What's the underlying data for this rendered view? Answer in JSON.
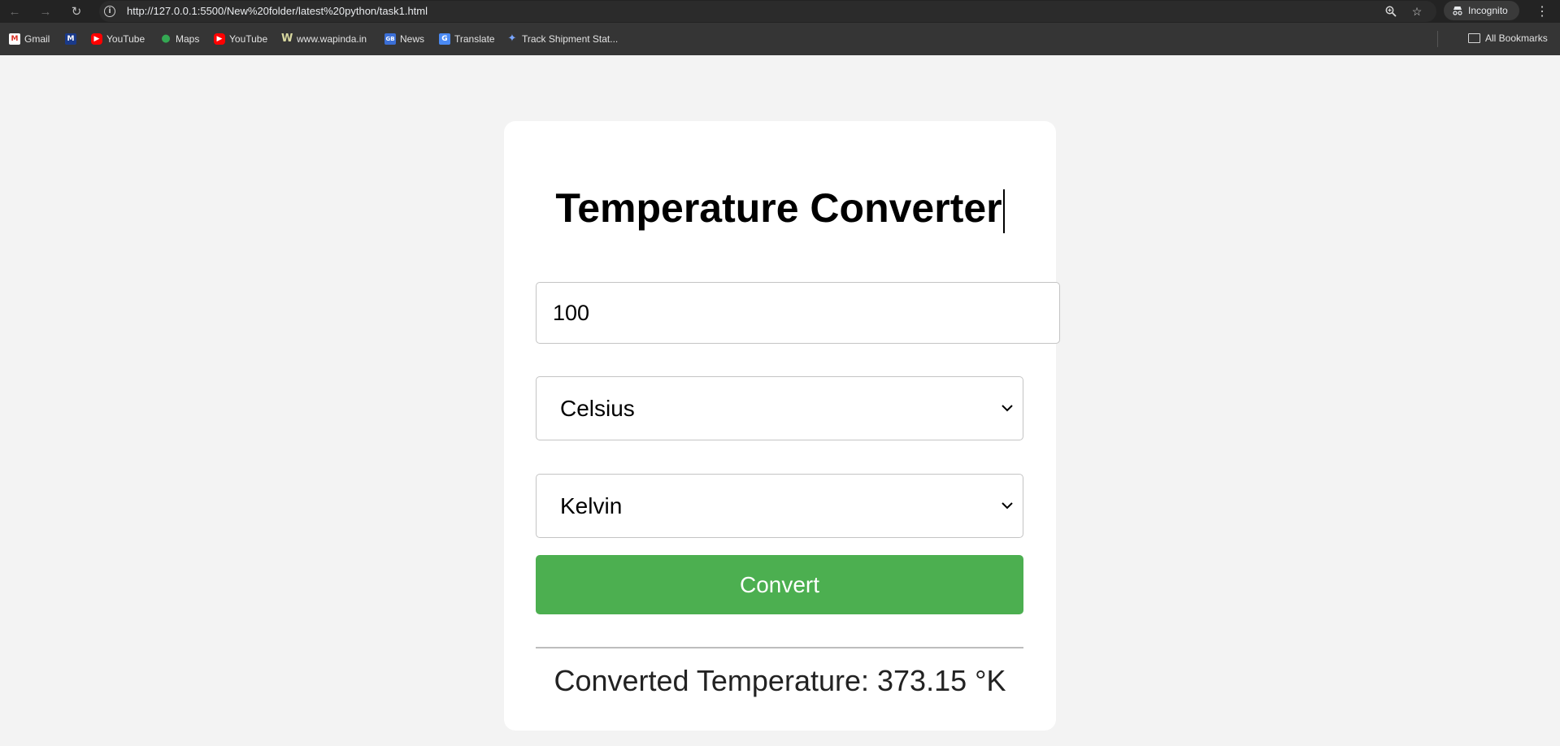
{
  "browser": {
    "url": "http://127.0.0.1:5500/New%20folder/latest%20python/task1.html",
    "incognito_label": "Incognito",
    "icons": [
      "back-icon",
      "forward-icon",
      "reload-icon",
      "info-icon",
      "zoom-icon",
      "star-icon",
      "incognito-icon",
      "kebab-menu-icon"
    ]
  },
  "bookmarks": {
    "items": [
      {
        "label": "Gmail",
        "icon": "gmail-icon"
      },
      {
        "label": "",
        "icon": "mail-icon"
      },
      {
        "label": "YouTube",
        "icon": "youtube-icon"
      },
      {
        "label": "Maps",
        "icon": "maps-icon"
      },
      {
        "label": "YouTube",
        "icon": "youtube-icon"
      },
      {
        "label": "www.wapinda.in",
        "icon": "wapinda-icon"
      },
      {
        "label": "News",
        "icon": "news-icon"
      },
      {
        "label": "Translate",
        "icon": "translate-icon"
      },
      {
        "label": "Track Shipment Stat...",
        "icon": "track-icon"
      }
    ],
    "all_bookmarks_label": "All Bookmarks"
  },
  "converter": {
    "title": "Temperature Converter",
    "input_value": "100",
    "from_unit": "Celsius",
    "to_unit": "Kelvin",
    "convert_label": "Convert",
    "result_text": "Converted Temperature: 373.15 °K"
  },
  "colors": {
    "page_bg": "#f3f3f3",
    "button_green": "#4caf50",
    "chrome_dark": "#232323",
    "bookmarks_bar": "#353535"
  }
}
